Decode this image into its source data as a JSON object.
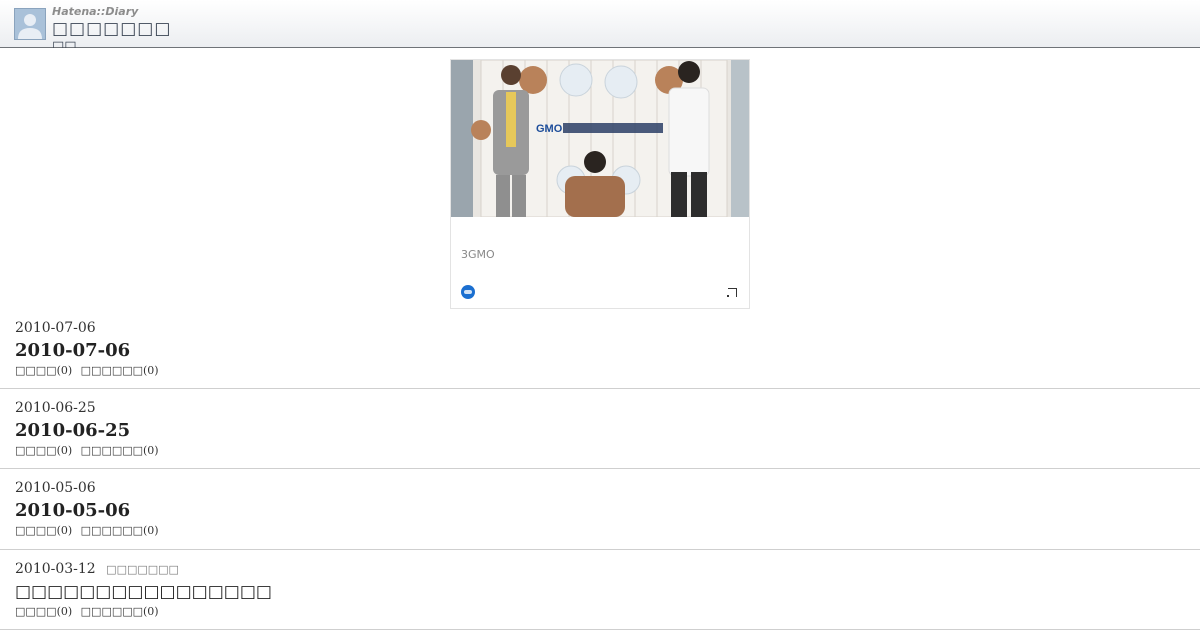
{
  "header": {
    "brand": "Hatena::Diary",
    "title": "□□□□□□□",
    "subtitle": "□□"
  },
  "ad": {
    "caption": "3GMO",
    "logo_icon": "hatena-logo-icon",
    "corner_icon": "expand-corner-icon",
    "accent": "#1b6fd0"
  },
  "entries": [
    {
      "date": "2010-07-06",
      "category": "",
      "title": "2010-07-06",
      "comments": "□□□□(0)",
      "trackbacks": "□□□□□□(0)"
    },
    {
      "date": "2010-06-25",
      "category": "",
      "title": "2010-06-25",
      "comments": "□□□□(0)",
      "trackbacks": "□□□□□□(0)"
    },
    {
      "date": "2010-05-06",
      "category": "",
      "title": "2010-05-06",
      "comments": "□□□□(0)",
      "trackbacks": "□□□□□□(0)"
    },
    {
      "date": "2010-03-12",
      "category": "□□□□□□□",
      "title": "□□□□□□□□□□□□□□□□",
      "comments": "□□□□(0)",
      "trackbacks": "□□□□□□(0)"
    }
  ]
}
